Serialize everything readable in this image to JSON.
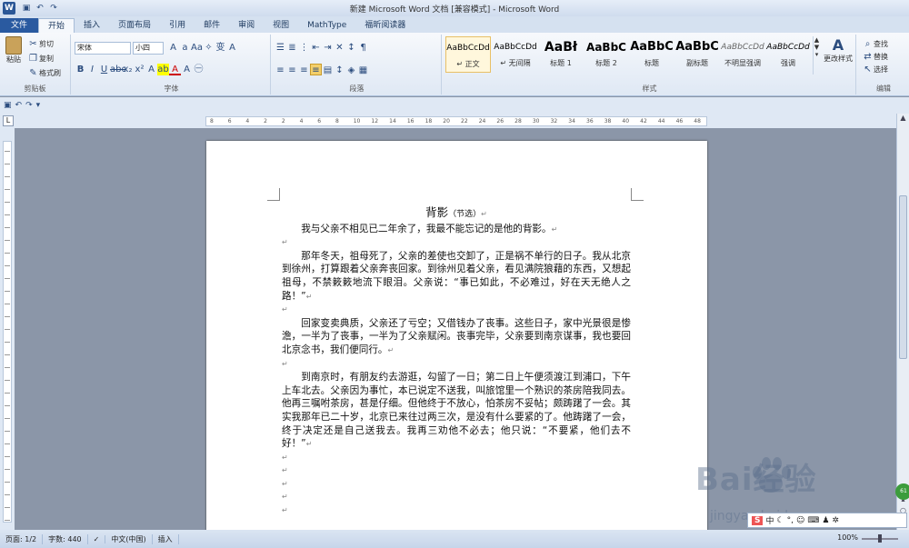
{
  "window": {
    "title": "新建 Microsoft Word 文档 [兼容模式] - Microsoft Word",
    "app_icon": "W"
  },
  "tabs": [
    "文件",
    "开始",
    "插入",
    "页面布局",
    "引用",
    "邮件",
    "审阅",
    "视图",
    "MathType",
    "福昕阅读器"
  ],
  "active_tab": "开始",
  "ribbon": {
    "clipboard": {
      "label": "剪贴板",
      "paste": "粘贴",
      "cut": "剪切",
      "copy": "复制",
      "format_painter": "格式刷"
    },
    "font": {
      "label": "字体",
      "font_name": "宋体",
      "font_size": "小四"
    },
    "paragraph": {
      "label": "段落"
    },
    "styles": {
      "label": "样式",
      "items": [
        {
          "sample": "AaBbCcDd",
          "name": "↵ 正文"
        },
        {
          "sample": "AaBbCcDd",
          "name": "↵ 无间隔"
        },
        {
          "sample": "AaBł",
          "name": "标题 1"
        },
        {
          "sample": "AaBbC",
          "name": "标题 2"
        },
        {
          "sample": "AaBbC",
          "name": "标题"
        },
        {
          "sample": "AaBbC",
          "name": "副标题"
        },
        {
          "sample": "AaBbCcDd",
          "name": "不明显强调"
        },
        {
          "sample": "AaBbCcDd",
          "name": "强调"
        }
      ],
      "change_styles": "更改样式"
    },
    "editing": {
      "label": "编辑",
      "find": "查找",
      "replace": "替换",
      "select": "选择"
    }
  },
  "ruler": {
    "labels": [
      "8",
      "6",
      "4",
      "2",
      "2",
      "4",
      "6",
      "8",
      "10",
      "12",
      "14",
      "16",
      "18",
      "20",
      "22",
      "24",
      "26",
      "28",
      "30",
      "32",
      "34",
      "36",
      "38",
      "40",
      "42",
      "44",
      "46",
      "48"
    ]
  },
  "document": {
    "title": "背影",
    "title_note": "（节选）",
    "line1": "我与父亲不相见已二年余了，我最不能忘记的是他的背影。",
    "para1": "那年冬天，祖母死了，父亲的差使也交卸了，正是祸不单行的日子。我从北京到徐州，打算跟着父亲奔丧回家。到徐州见着父亲，看见满院狼藉的东西，又想起祖母，不禁簌簌地流下眼泪。父亲说：“事已如此，不必难过，好在天无绝人之路！”",
    "para2": "回家变卖典质，父亲还了亏空；又借钱办了丧事。这些日子，家中光景很是惨澹，一半为了丧事，一半为了父亲赋闲。丧事完毕，父亲要到南京谋事，我也要回北京念书，我们便同行。",
    "para3": "到南京时，有朋友约去游逛，勾留了一日；第二日上午便须渡江到浦口，下午上车北去。父亲因为事忙，本已说定不送我，叫旅馆里一个熟识的茶房陪我同去。他再三嘱咐茶房，甚是仔细。但他终于不放心，怕茶房不妥帖；颇踌躇了一会。其实我那年已二十岁，北京已来往过两三次，是没有什么要紧的了。他踌躇了一会，终于决定还是自己送我去。我再三劝他不必去；他只说：“不要紧，他们去不好！”"
  },
  "status": {
    "page": "页面: 1/2",
    "words": "字数: 440",
    "language": "中文(中国)",
    "mode": "插入",
    "zoom": "100%"
  },
  "watermark": {
    "brand": "Bai经验",
    "url": "jingyan.baidu.com"
  },
  "ime": {
    "label": "S"
  }
}
